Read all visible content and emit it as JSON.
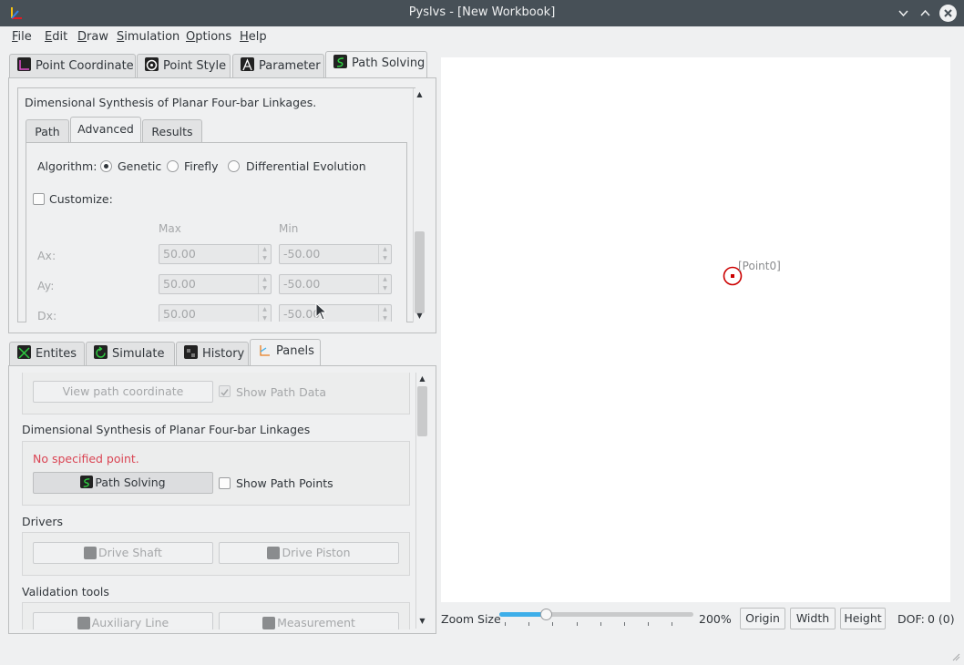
{
  "window": {
    "title": "Pyslvs - [New Workbook]",
    "minimize_icon": "chevron-down-icon",
    "maximize_icon": "chevron-up-icon",
    "close_icon": "close-icon"
  },
  "menu": [
    "File",
    "Edit",
    "Draw",
    "Simulation",
    "Options",
    "Help"
  ],
  "top_tabs": [
    {
      "label": "Point Coordinate",
      "icon": "point-coordinate-icon"
    },
    {
      "label": "Point Style",
      "icon": "point-style-icon"
    },
    {
      "label": "Parameter",
      "icon": "parameter-icon"
    },
    {
      "label": "Path Solving",
      "icon": "path-solving-icon",
      "active": true
    }
  ],
  "synthesis": {
    "heading": "Dimensional Synthesis of Planar Four-bar Linkages.",
    "tabs": [
      {
        "label": "Path"
      },
      {
        "label": "Advanced",
        "active": true
      },
      {
        "label": "Results"
      }
    ],
    "algorithm_label": "Algorithm:",
    "algorithms": [
      {
        "label": "Genetic",
        "selected": true
      },
      {
        "label": "Firefly",
        "selected": false
      },
      {
        "label": "Differential Evolution",
        "selected": false
      }
    ],
    "customize_label": "Customize:",
    "customize_checked": false,
    "col_max": "Max",
    "col_min": "Min",
    "rows": [
      {
        "label": "Ax:",
        "max": "50.00",
        "min": "-50.00"
      },
      {
        "label": "Ay:",
        "max": "50.00",
        "min": "-50.00"
      },
      {
        "label": "Dx:",
        "max": "50.00",
        "min": "-50.00"
      }
    ]
  },
  "bottom_tabs": [
    {
      "label": "Entites",
      "icon": "entities-icon"
    },
    {
      "label": "Simulate",
      "icon": "simulate-icon"
    },
    {
      "label": "History",
      "icon": "history-icon"
    },
    {
      "label": "Panels",
      "icon": "panels-icon",
      "active": true
    }
  ],
  "panels": {
    "view_path_button": "View path coordinate",
    "show_path_data": "Show Path Data",
    "show_path_data_checked": true,
    "synthesis_heading": "Dimensional Synthesis of Planar Four-bar Linkages",
    "warning": "No specified point.",
    "warning_color": "#da4453",
    "path_solving_button": "Path Solving",
    "show_path_points": "Show Path Points",
    "drivers_heading": "Drivers",
    "drive_shaft": "Drive Shaft",
    "drive_piston": "Drive Piston",
    "validation_heading": "Validation tools",
    "auxiliary_line": "Auxiliary Line",
    "measurement": "Measurement"
  },
  "canvas": {
    "point_label": "[Point0]",
    "point_color": "#cc0000"
  },
  "status": {
    "zoom_label": "Zoom Size",
    "zoom_value": "200%",
    "zoom_fraction": 0.24,
    "origin": "Origin",
    "width": "Width",
    "height": "Height",
    "dof_label": "DOF:",
    "dof_value": "0 (0)"
  },
  "colors": {
    "accent": "#3daee9",
    "titlebar": "#475057"
  }
}
